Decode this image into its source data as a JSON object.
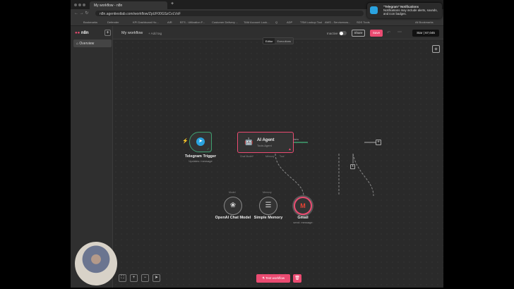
{
  "browser": {
    "tab_title": "My workflow - n8n",
    "url": "n8n.agentiestlab.com/workflow/ZpUF00GSzCvLVsF",
    "bookmarks": [
      "Bookmarks",
      "Defender",
      "KPI Dashboard Ho...",
      "AIR",
      "BTS - Utilization F...",
      "Customer Delivery ...",
      "TAM Account Look...",
      "Q",
      "ADP",
      "TSM Lookup Tool",
      "AWS - Servicenow...",
      "SDS Tools",
      "All Bookmarks"
    ]
  },
  "notification": {
    "title": "\"Telegram\" Notifications",
    "body": "Notifications may include alerts, sounds, and icon badges."
  },
  "sidebar": {
    "logo": "n8n",
    "items": [
      {
        "label": "Overview"
      }
    ]
  },
  "header": {
    "title": "My workflow",
    "add_tag": "+ Add tag",
    "status": "Inactive",
    "share": "Share",
    "save": "Save",
    "star": "Star",
    "star_count": "67,045",
    "tabs": [
      "Editor",
      "Executions"
    ]
  },
  "nodes": {
    "trigger": {
      "name": "Telegram Trigger",
      "sub": "Updates: message"
    },
    "agent": {
      "name": "AI Agent",
      "sub": "Tools Agent",
      "ports": [
        "Chat Model*",
        "Memory",
        "Tool"
      ]
    },
    "connection_label": "1 item",
    "model": {
      "name": "OpenAI Chat Model",
      "port": "Model"
    },
    "memory": {
      "name": "Simple Memory",
      "port": "Memory"
    },
    "gmail": {
      "name": "Gmail",
      "sub": "send: message"
    }
  },
  "footer": {
    "test_workflow": "Test workflow"
  },
  "colors": {
    "accent": "#ea4b71",
    "success": "#3f9f6f",
    "telegram": "#2aa3e0"
  }
}
